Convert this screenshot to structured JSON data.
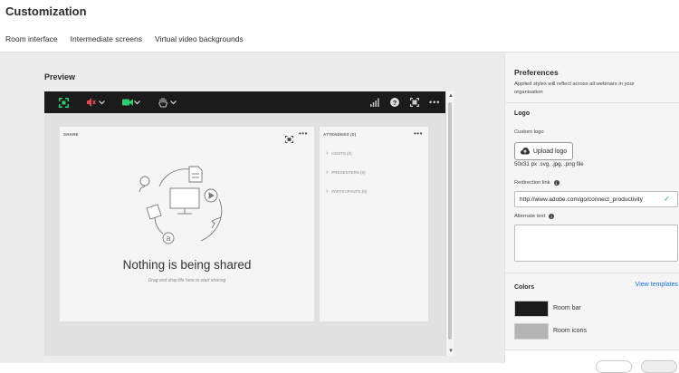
{
  "page": {
    "title": "Customization"
  },
  "tabs": [
    {
      "label": "Room interface",
      "active": true
    },
    {
      "label": "Intermediate screens",
      "active": false
    },
    {
      "label": "Virtual video backgrounds",
      "active": false
    }
  ],
  "preview": {
    "label": "Preview",
    "room_bar_icons": [
      "fullscreen-icon",
      "mic-muted-icon",
      "chevron-down-icon",
      "camera-icon",
      "chevron-down-icon",
      "raise-hand-icon",
      "chevron-down-icon",
      "signal-icon",
      "help-icon",
      "layout-icon",
      "more-icon"
    ],
    "share_pod": {
      "title": "SHARE",
      "empty_title": "Nothing is being shared",
      "empty_subtitle": "Drag and drop file here to start sharing"
    },
    "attendees_pod": {
      "title": "ATTENDEES (0)",
      "groups": [
        "HOSTS (0)",
        "PRESENTERS (0)",
        "PARTICIPANTS (0)"
      ]
    }
  },
  "preferences": {
    "title": "Preferences",
    "description": "Applied styles will reflect across all webinars in your organisation",
    "logo": {
      "section_title": "Logo",
      "custom_logo_label": "Custom logo",
      "upload_button": "Upload logo",
      "formats": "50x31 px .svg, .jpg, .png file",
      "redirection_label": "Redirection link",
      "redirection_value": "http://www.adobe.com/go/connect_productivity",
      "alt_text_label": "Alternate text",
      "alt_text_value": ""
    },
    "colors": {
      "section_title": "Colors",
      "view_templates": "View templates",
      "items": [
        {
          "label": "Room bar",
          "color": "#1b1b1b"
        },
        {
          "label": "Room icons",
          "color": "#b4b4b4"
        }
      ]
    }
  }
}
